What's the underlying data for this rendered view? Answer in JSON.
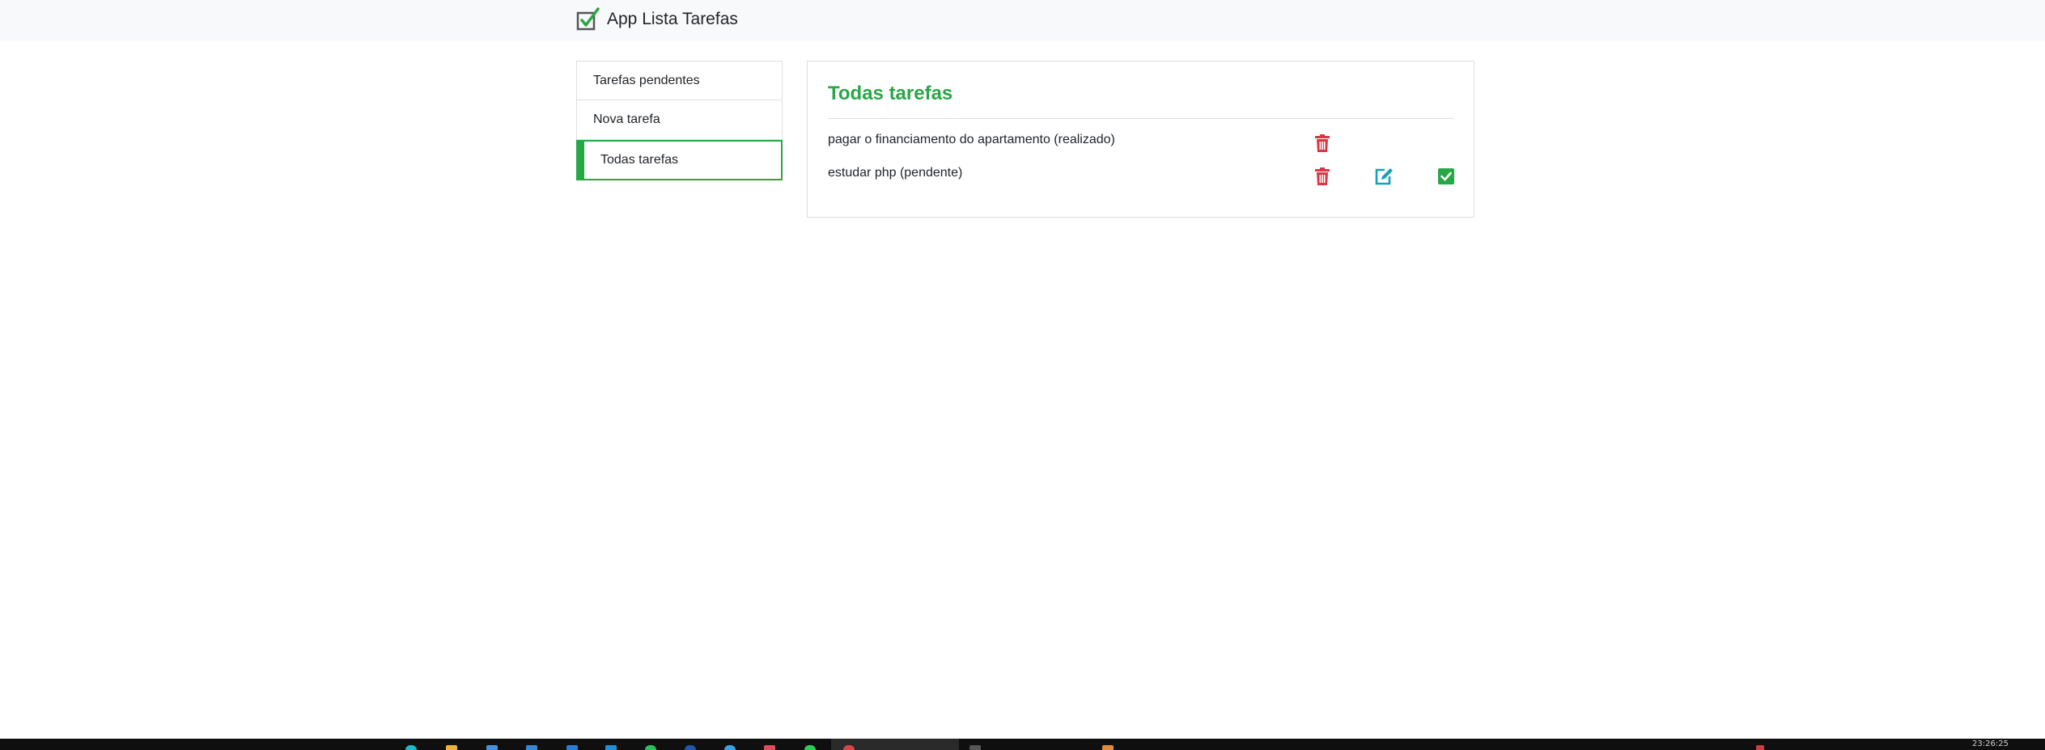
{
  "app": {
    "title": "App Lista Tarefas"
  },
  "menu": {
    "items": [
      {
        "label": "Tarefas pendentes",
        "active": false
      },
      {
        "label": "Nova tarefa",
        "active": false
      },
      {
        "label": "Todas tarefas",
        "active": true
      }
    ]
  },
  "main": {
    "title": "Todas tarefas",
    "tasks": [
      {
        "text": "pagar o financiamento do apartamento (realizado)",
        "status": "realizado",
        "actions": [
          "delete-icon"
        ]
      },
      {
        "text": "estudar php (pendente)",
        "status": "pendente",
        "actions": [
          "delete-icon",
          "edit-icon",
          "check-icon"
        ]
      }
    ]
  },
  "colors": {
    "accent": "#28a745",
    "delete": "#dc3545",
    "edit": "#17a2b8",
    "navbar": "#f8f9fa"
  },
  "taskbar": {
    "clock": "23:26:25"
  }
}
